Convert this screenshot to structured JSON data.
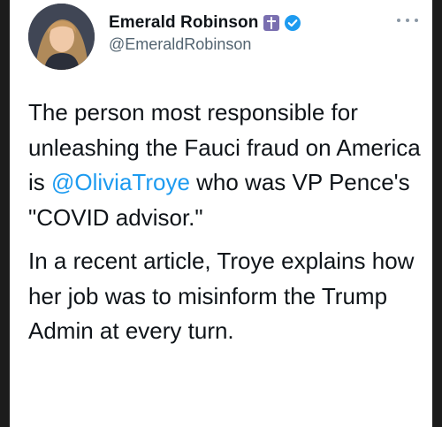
{
  "tweet": {
    "author": {
      "display_name": "Emerald Robinson",
      "handle": "@EmeraldRobinson",
      "badges": [
        "cross-icon",
        "verified-icon"
      ]
    },
    "paragraphs": [
      {
        "before": "The person most responsible for unleashing the Fauci fraud on America is ",
        "mention": "@OliviaTroye",
        "after": " who was VP Pence's \"COVID advisor.\""
      },
      {
        "text": "In a recent article, Troye explains how her job was to misinform the Trump Admin at every turn."
      }
    ]
  },
  "colors": {
    "mention": "#1d9bf0",
    "verified": "#1d9bf0",
    "cross_badge": "#7a6fb0",
    "text": "#0f1419",
    "handle": "#536471"
  }
}
